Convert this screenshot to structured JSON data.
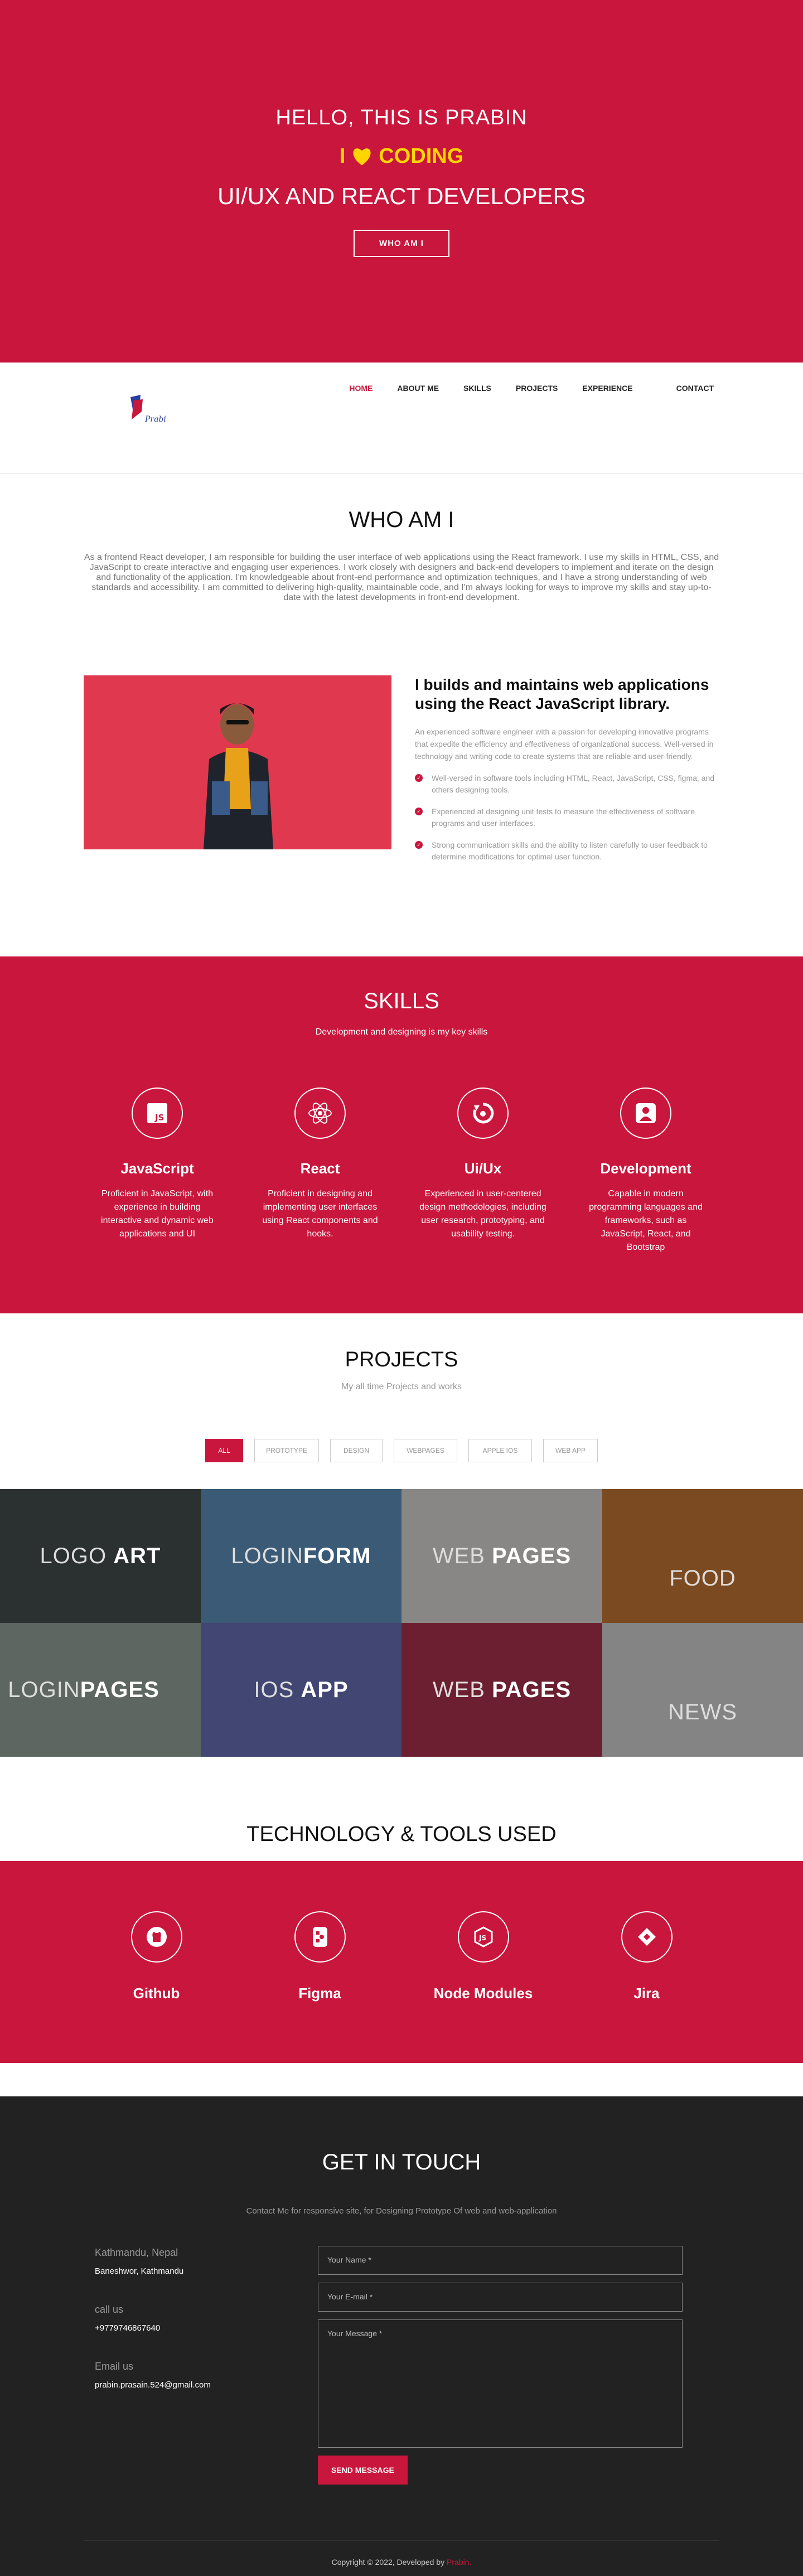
{
  "hero": {
    "greeting": "HELLO, THIS IS PRABIN",
    "love_pre": "I",
    "love_post": "CODING",
    "role": "UI/UX AND REACT DEVELOPERS",
    "button": "WHO AM I"
  },
  "nav": {
    "logo_text": "Prabin",
    "items": [
      "HOME",
      "ABOUT ME",
      "SKILLS",
      "PROJECTS",
      "EXPERIENCE",
      "CONTACT"
    ]
  },
  "who": {
    "title": "WHO AM I",
    "text": "As a frontend React developer, I am responsible for building the user interface of web applications using the React framework. I use my skills in HTML, CSS, and JavaScript to create interactive and engaging user experiences. I work closely with designers and back-end developers to implement and iterate on the design and functionality of the application. I'm knowledgeable about front-end performance and optimization techniques, and I have a strong understanding of web standards and accessibility. I am committed to delivering high-quality, maintainable code, and I'm always looking for ways to improve my skills and stay up-to-date with the latest developments in front-end development."
  },
  "about": {
    "heading": "I builds and maintains web applications using the React JavaScript library.",
    "lead": "An experienced software engineer with a passion for developing innovative programs that expedite the efficiency and effectiveness of organizational success. Well-versed in technology and writing code to create systems that are reliable and user-friendly.",
    "bullets": [
      "Well-versed in software tools including HTML, React, JavaScript, CSS, figma, and others designing tools.",
      "Experienced at designing unit tests to measure the effectiveness of software programs and user interfaces.",
      "Strong communication skills and the ability to listen carefully to user feedback to determine modifications for optimal user function."
    ]
  },
  "skills": {
    "title": "SKILLS",
    "subtitle": "Development and designing is my key skills",
    "items": [
      {
        "name": "JavaScript",
        "desc": "Proficient in JavaScript, with experience in building interactive and dynamic web applications and UI",
        "icon": "js-icon"
      },
      {
        "name": "React",
        "desc": "Proficient in designing and implementing user interfaces using React components and hooks.",
        "icon": "react-icon"
      },
      {
        "name": "Ui/Ux",
        "desc": "Experienced in user-centered design methodologies, including user research, prototyping, and usability testing.",
        "icon": "design-icon"
      },
      {
        "name": "Development",
        "desc": "Capable in modern programming languages and frameworks, such as JavaScript, React, and Bootstrap",
        "icon": "user-icon"
      }
    ]
  },
  "projects": {
    "title": "PROJECTS",
    "subtitle": "My all time Projects and works",
    "filters": [
      "ALL",
      "PROTOTYPE",
      "DESIGN",
      "WEBPAGES",
      "APPLE IOS",
      "WEB APP"
    ],
    "tiles": [
      {
        "a": "LOGO ",
        "b": "ART",
        "bg": "#2e3a37"
      },
      {
        "a": "LOGIN",
        "b": "FORM",
        "bg": "#4a84b6"
      },
      {
        "a": "WEB ",
        "b": "PAGES",
        "bg": "#d7d5d2"
      },
      {
        "a": "FOOD",
        "b": "",
        "bg": "#c2661c"
      },
      {
        "a": "LOGIN",
        "b": "PAGES",
        "bg": "#8a9a92"
      },
      {
        "a": "IOS ",
        "b": "APP",
        "bg": "#5860b0"
      },
      {
        "a": "WEB ",
        "b": "PAGES",
        "bg": "#a51838"
      },
      {
        "a": "NEWS",
        "b": "",
        "bg": "#cfcfcf"
      }
    ]
  },
  "tech": {
    "title": "TECHNOLOGY & TOOLS USED",
    "items": [
      {
        "name": "Github",
        "icon": "github-icon"
      },
      {
        "name": "Figma",
        "icon": "figma-icon"
      },
      {
        "name": "Node Modules",
        "icon": "node-icon"
      },
      {
        "name": "Jira",
        "icon": "jira-icon"
      }
    ]
  },
  "contact": {
    "title": "GET IN TOUCH",
    "subtitle": "Contact Me for responsive site, for Designing Prototype Of web and web-application",
    "loc_k": "Kathmandu, Nepal",
    "loc_v": "Baneshwor, Kathmandu",
    "call_k": "call us",
    "call_v": "+9779746867640",
    "email_k": "Email us",
    "email_v": "prabin.prasain.524@gmail.com",
    "name_ph": "Your Name *",
    "email_ph": "Your E-mail *",
    "msg_ph": "Your Message *",
    "send": "SEND MESSAGE"
  },
  "footer": {
    "text": "Copyright © 2022, Developed by",
    "name": "Prabin."
  },
  "colors": {
    "accent": "#c9163c",
    "yellow": "#ffd400",
    "dark": "#222222"
  }
}
